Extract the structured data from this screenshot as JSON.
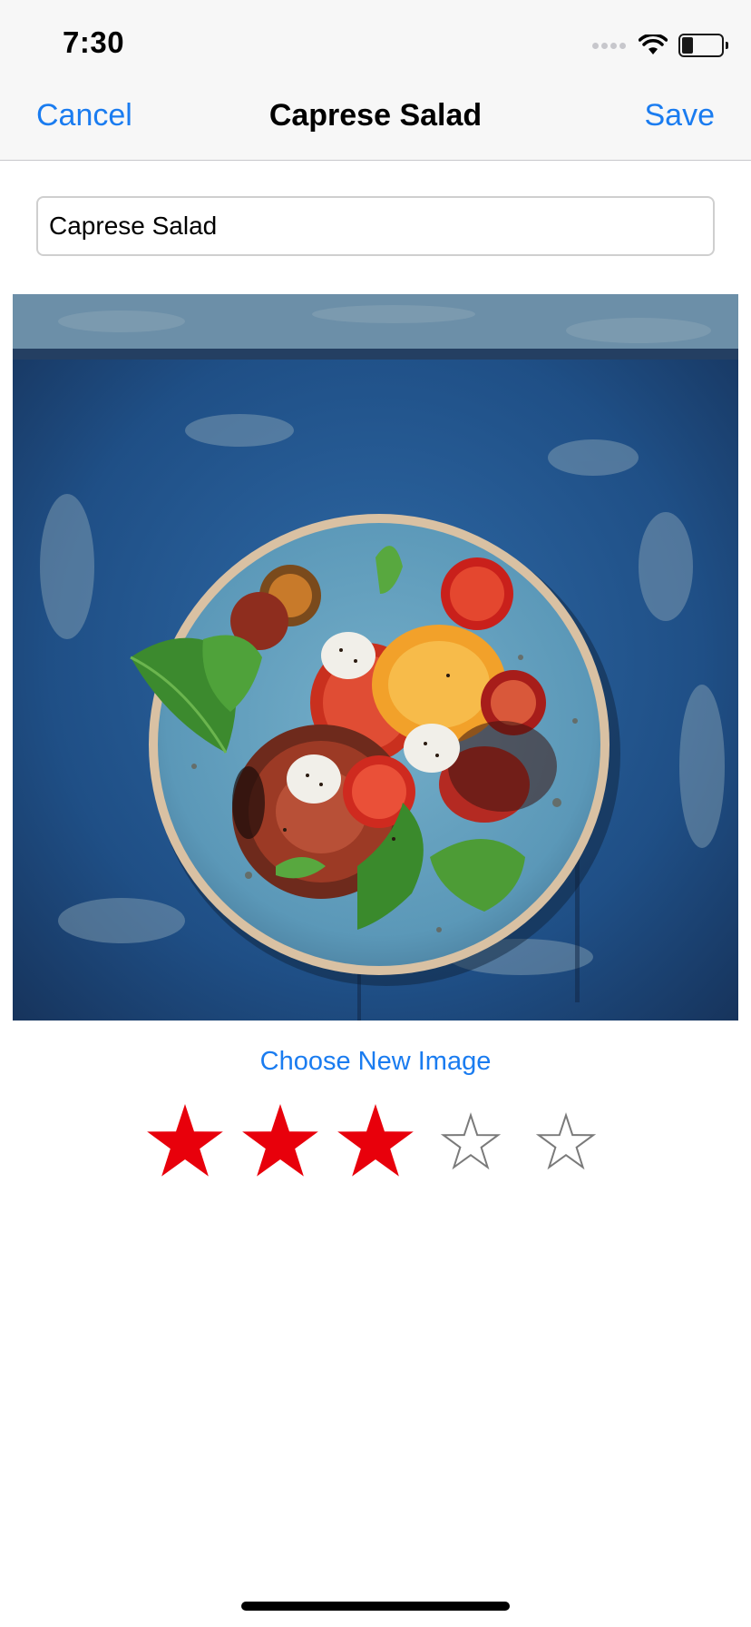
{
  "status_bar": {
    "time": "7:30"
  },
  "nav": {
    "cancel_label": "Cancel",
    "title": "Caprese Salad",
    "save_label": "Save"
  },
  "form": {
    "name_value": "Caprese Salad",
    "choose_image_label": "Choose New Image"
  },
  "rating": {
    "value": 3,
    "max": 5,
    "filled_color": "#e8000b",
    "empty_color": "#7a7a7a"
  },
  "colors": {
    "accent": "#1a7cf0",
    "nav_bg": "#f7f7f7"
  },
  "icons": [
    "wifi-icon",
    "battery-icon",
    "signal-icon",
    "star-icon"
  ]
}
